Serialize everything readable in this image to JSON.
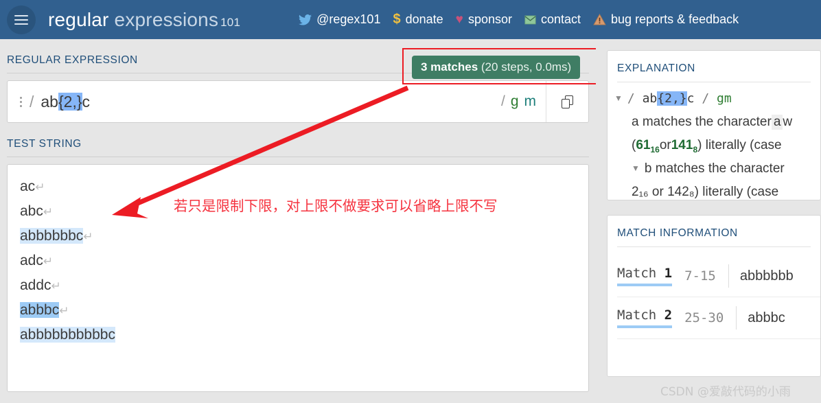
{
  "header": {
    "brand_bold": "regular",
    "brand_light": "expressions",
    "brand_suffix": "101",
    "menu_icon": "hamburger-icon",
    "nav": [
      {
        "icon": "twitter-icon",
        "glyph": "ᴠ",
        "label": "@regex101"
      },
      {
        "icon": "dollar-icon",
        "glyph": "$",
        "label": "donate"
      },
      {
        "icon": "heart-icon",
        "glyph": "♥",
        "label": "sponsor"
      },
      {
        "icon": "mail-icon",
        "glyph": "✉",
        "label": "contact"
      },
      {
        "icon": "warning-icon",
        "glyph": "⚠",
        "label": "bug reports & feedback"
      }
    ]
  },
  "regex_section": {
    "title": "REGULAR EXPRESSION",
    "menu_icon": "vertical-dots-icon",
    "open_delimiter": "/",
    "pattern_prefix": "ab",
    "pattern_highlight": "{2,}",
    "pattern_suffix": "c",
    "close_delimiter": "/",
    "flag_g": "g",
    "flag_m": "m",
    "copy_icon": "copy-icon"
  },
  "match_badge": {
    "count_text": "3 matches",
    "detail_text": " (20 steps, 0.0ms)",
    "bg_color": "#3f7d64",
    "highlight_box_color": "#ec1c24"
  },
  "test_section": {
    "title": "TEST STRING",
    "pilcrow": "↵",
    "lines": [
      {
        "text": "ac",
        "match": "none",
        "newline": true
      },
      {
        "text": "abc",
        "match": "none",
        "newline": true
      },
      {
        "text": "abbbbbbc",
        "match": "m1",
        "newline": true
      },
      {
        "text": "adc",
        "match": "none",
        "newline": true
      },
      {
        "text": "addc",
        "match": "none",
        "newline": true
      },
      {
        "text": "abbbc",
        "match": "m2",
        "newline": true
      },
      {
        "text": "abbbbbbbbbbc",
        "match": "m1",
        "newline": false
      }
    ]
  },
  "annotation": {
    "text": "若只是限制下限，对上限不做要求可以省略上限不写",
    "color": "#f5333f",
    "arrow_icon": "red-arrow-icon"
  },
  "explanation": {
    "title": "EXPLANATION",
    "header_row": {
      "caret": "▼",
      "slash_open": "/",
      "pattern_prefix": "ab",
      "pattern_highlight": "{2,}",
      "pattern_suffix": "c",
      "slash_close": "/",
      "flags": "gm"
    },
    "rows": [
      {
        "text_a": "a matches the character ",
        "chip": "a",
        "text_b": " w"
      },
      {
        "paren_open": "(",
        "hex": "61",
        "hex_sub": "16",
        "or": " or ",
        "oct": "141",
        "oct_sub": "8",
        "tail": ") literally (case"
      },
      {
        "caret": "▼",
        "text": "b matches the character "
      },
      {
        "clipped": "2₁₆ or 142₈) literally (case"
      }
    ]
  },
  "match_information": {
    "title": "MATCH INFORMATION",
    "rows": [
      {
        "label_prefix": "Match ",
        "label_index": "1",
        "range": "7-15",
        "value": "abbbbbb"
      },
      {
        "label_prefix": "Match ",
        "label_index": "2",
        "range": "25-30",
        "value": "abbbc"
      }
    ]
  },
  "watermark": {
    "text": "CSDN @爱敲代码的小雨"
  }
}
